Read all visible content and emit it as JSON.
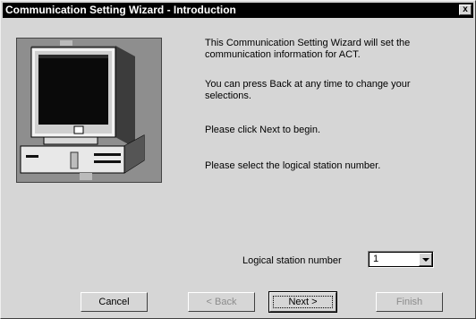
{
  "window": {
    "title": "Communication Setting Wizard - Introduction",
    "close_glyph": "x"
  },
  "illustration": {
    "icon": "computer-illustration"
  },
  "intro": {
    "p1_line1": "This Communication Setting Wizard will set the",
    "p1_line2": "communication information for ACT.",
    "p2_line1": "You can press Back at any time to change your",
    "p2_line2": "selections.",
    "p3": "Please click Next to begin.",
    "p4": "Please select the logical station number."
  },
  "station": {
    "label": "Logical station number",
    "value": "1"
  },
  "buttons": {
    "cancel": "Cancel",
    "back": "< Back",
    "next": "Next >",
    "finish": "Finish"
  },
  "colors": {
    "dialog_bg": "#d6d6d6",
    "titlebar_bg": "#000000",
    "disabled_text": "#8c8c8c"
  }
}
